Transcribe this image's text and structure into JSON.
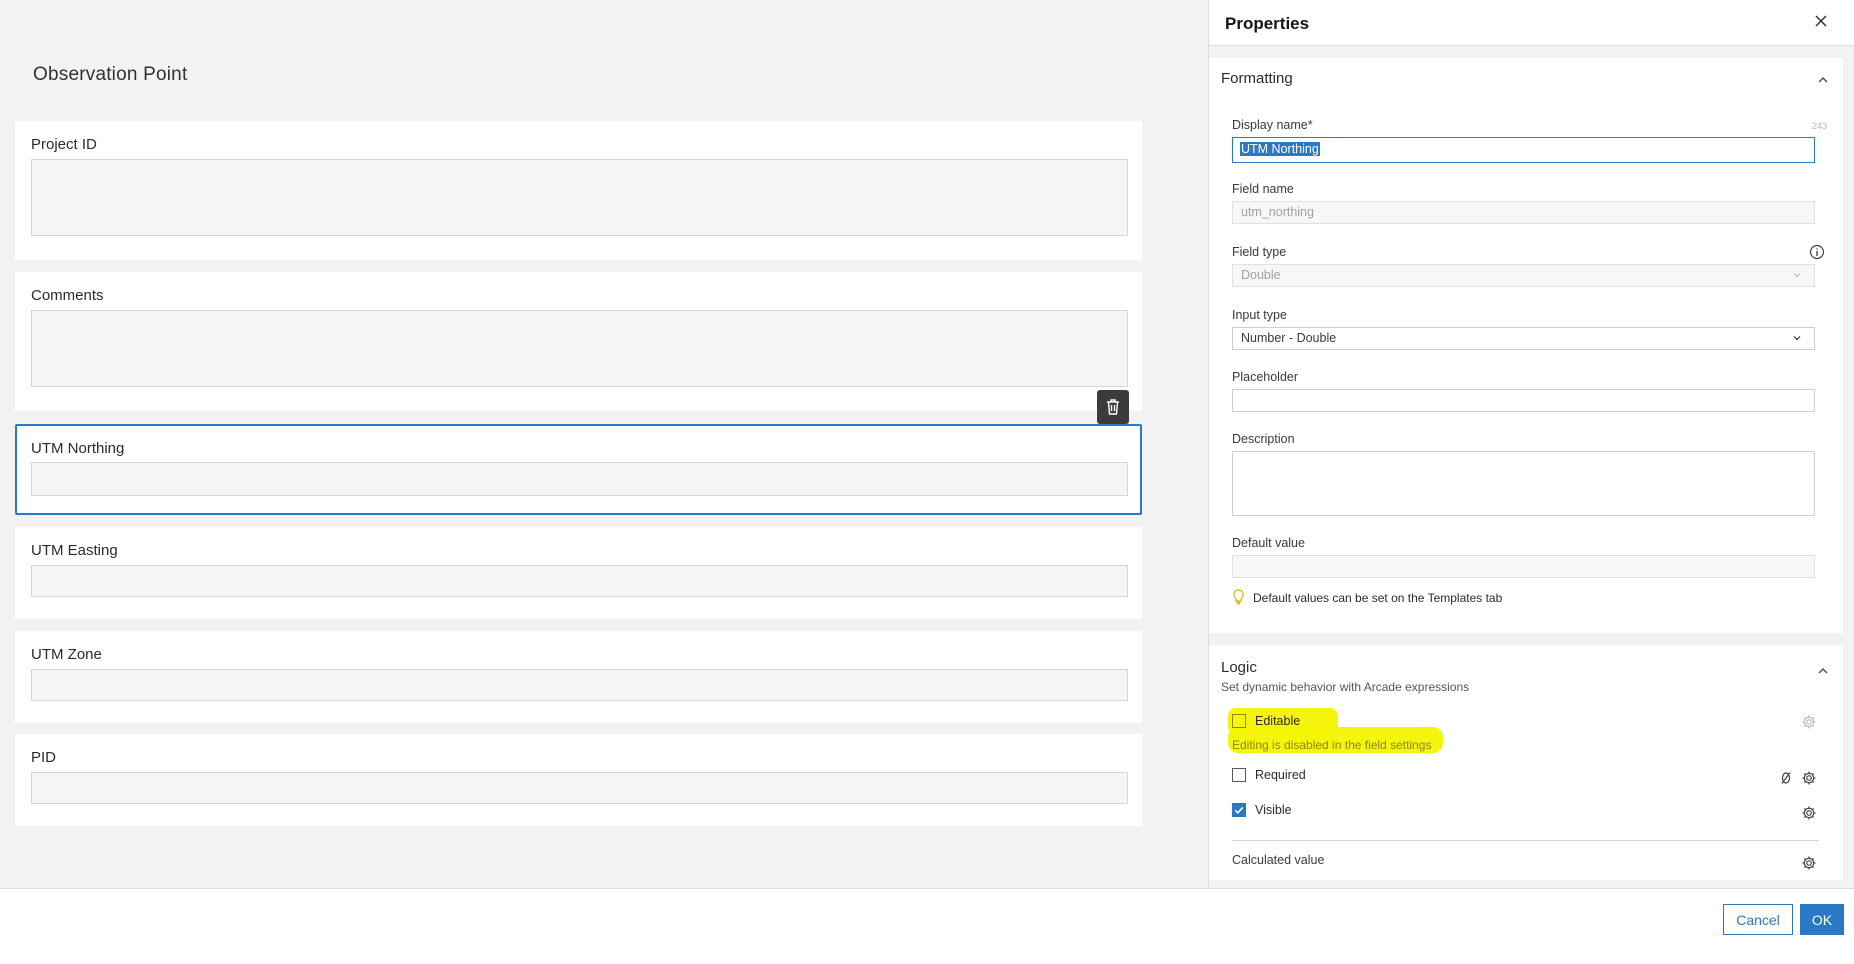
{
  "form": {
    "title": "Observation Point",
    "fields": [
      {
        "label": "Project ID"
      },
      {
        "label": "Comments"
      },
      {
        "label": "UTM Northing"
      },
      {
        "label": "UTM Easting"
      },
      {
        "label": "UTM Zone"
      },
      {
        "label": "PID"
      }
    ],
    "selected_index": 2
  },
  "properties": {
    "title": "Properties",
    "formatting": {
      "title": "Formatting",
      "display_name_label": "Display name*",
      "display_name_value": "UTM Northing",
      "display_name_counter": "243",
      "field_name_label": "Field name",
      "field_name_value": "utm_northing",
      "field_type_label": "Field type",
      "field_type_value": "Double",
      "input_type_label": "Input type",
      "input_type_value": "Number - Double",
      "placeholder_label": "Placeholder",
      "description_label": "Description",
      "default_value_label": "Default value",
      "default_hint": "Default values can be set on the Templates tab"
    },
    "logic": {
      "title": "Logic",
      "subtitle": "Set dynamic behavior with Arcade expressions",
      "editable_label": "Editable",
      "editable_checked": false,
      "editable_note": "Editing is disabled in the field settings",
      "required_label": "Required",
      "required_checked": false,
      "visible_label": "Visible",
      "visible_checked": true,
      "calculated_label": "Calculated value"
    }
  },
  "footer": {
    "cancel_label": "Cancel",
    "ok_label": "OK"
  },
  "colors": {
    "accent": "#2b78c5",
    "highlight": "#f3f300"
  }
}
